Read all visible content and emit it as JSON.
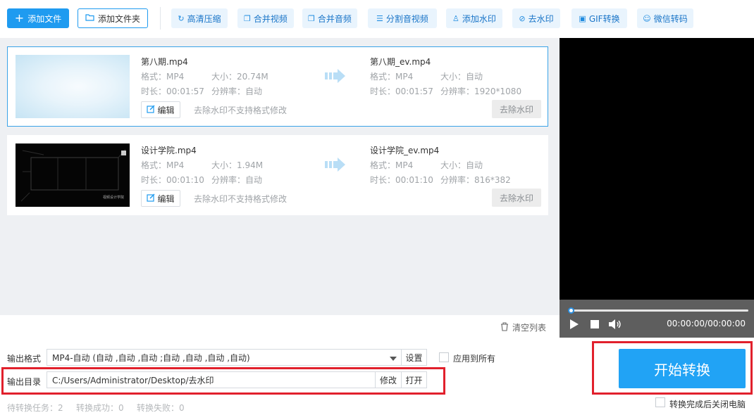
{
  "toolbar": {
    "add_file": "添加文件",
    "add_folder": "添加文件夹",
    "tools": [
      {
        "label": "高清压缩",
        "icon": "compress-icon"
      },
      {
        "label": "合并视频",
        "icon": "merge-video-icon"
      },
      {
        "label": "合并音频",
        "icon": "merge-audio-icon"
      },
      {
        "label": "分割音视频",
        "icon": "split-icon"
      },
      {
        "label": "添加水印",
        "icon": "add-watermark-icon"
      },
      {
        "label": "去水印",
        "icon": "remove-watermark-icon"
      },
      {
        "label": "GIF转换",
        "icon": "gif-icon"
      },
      {
        "label": "微信转码",
        "icon": "wechat-icon"
      }
    ]
  },
  "files": [
    {
      "source_name": "第八期.mp4",
      "source_format": "格式：MP4",
      "source_size": "大小：20.74M",
      "source_duration": "时长：00:01:57",
      "source_resolution": "分辨率：自动",
      "target_name": "第八期_ev.mp4",
      "target_format": "格式：MP4",
      "target_size": "大小：自动",
      "target_duration": "时长：00:01:57",
      "target_resolution": "分辨率：1920*1080",
      "edit_label": "编辑",
      "note": "去除水印不支持格式修改",
      "remove_wm_label": "去除水印"
    },
    {
      "source_name": "设计学院.mp4",
      "source_format": "格式：MP4",
      "source_size": "大小：1.94M",
      "source_duration": "时长：00:01:10",
      "source_resolution": "分辨率：自动",
      "target_name": "设计学院_ev.mp4",
      "target_format": "格式：MP4",
      "target_size": "大小：自动",
      "target_duration": "时长：00:01:10",
      "target_resolution": "分辨率：816*382",
      "edit_label": "编辑",
      "note": "去除水印不支持格式修改",
      "remove_wm_label": "去除水印",
      "thumb_caption": "视频设计学院"
    }
  ],
  "player": {
    "time": "00:00:00/00:00:00",
    "progress": 0
  },
  "bottom": {
    "clear_list": "清空列表",
    "output_format_label": "输出格式",
    "output_format_value": "MP4-自动 (自动 ,自动 ,自动 ;自动 ,自动 ,自动 ,自动)",
    "settings": "设置",
    "apply_all": "应用到所有",
    "output_dir_label": "输出目录",
    "output_dir_value": "C:/Users/Administrator/Desktop/去水印",
    "modify": "修改",
    "open": "打开",
    "start": "开始转换",
    "shutdown_after": "转换完成后关闭电脑",
    "pending": "待转换任务：2",
    "success": "转换成功：0",
    "failed": "转换失败：0"
  },
  "colors": {
    "accent": "#1f9bf0",
    "highlight_box": "#e1202c"
  }
}
